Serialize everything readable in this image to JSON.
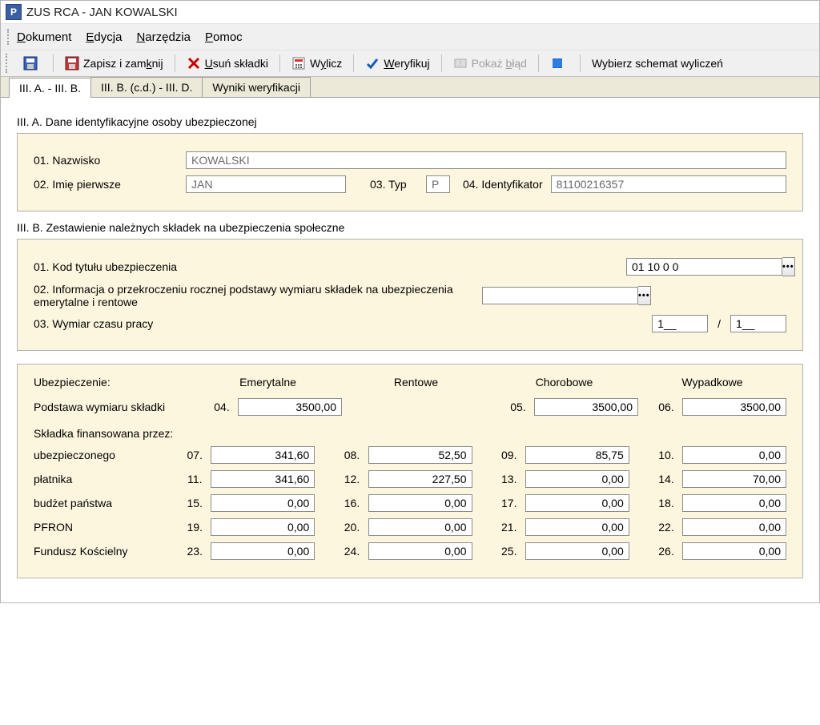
{
  "window_title": "ZUS RCA - JAN KOWALSKI",
  "menus": {
    "dokument": "Dokument",
    "edycja": "Edycja",
    "narzedzia": "Narzędzia",
    "pomoc": "Pomoc"
  },
  "toolbar": {
    "zapisz_i_zamknij": "Zapisz i zamknij",
    "usun_skladki": "Usuń składki",
    "wylicz": "Wylicz",
    "weryfikuj": "Weryfikuj",
    "pokaz_blad": "Pokaż błąd",
    "wybierz_schemat": "Wybierz schemat wyliczeń"
  },
  "tabs": {
    "tab1": "III. A. - III. B.",
    "tab2": "III. B. (c.d.) - III. D.",
    "tab3": "Wyniki weryfikacji"
  },
  "sectionA": {
    "header": "III. A. Dane identyfikacyjne osoby ubezpieczonej",
    "l_nazwisko": "01. Nazwisko",
    "v_nazwisko": "KOWALSKI",
    "l_imie": "02. Imię pierwsze",
    "v_imie": "JAN",
    "l_typ": "03. Typ",
    "v_typ": "P",
    "l_id": "04. Identyfikator",
    "v_id": "81100216357"
  },
  "sectionB": {
    "header": "III. B. Zestawienie należnych składek na ubezpieczenia społeczne",
    "l_kod": "01. Kod tytułu ubezpieczenia",
    "v_kod": "01 10 0 0",
    "l_info": "02. Informacja o przekroczeniu rocznej podstawy wymiaru składek na ubezpieczenia emerytalne i rentowe",
    "v_info": "",
    "l_wym": "03. Wymiar czasu pracy",
    "wym_a": "1__",
    "wym_sep": "/",
    "wym_b": "1__"
  },
  "grid": {
    "h_ubezp": "Ubezpieczenie:",
    "h_emeryt": "Emerytalne",
    "h_rent": "Rentowe",
    "h_chor": "Chorobowe",
    "h_wyp": "Wypadkowe",
    "h_podstawa": "Podstawa wymiaru składki",
    "h_finansowana": "Składka finansowana przez:",
    "basis": {
      "n04": "04.",
      "v04": "3500,00",
      "n05": "05.",
      "v05": "3500,00",
      "n06": "06.",
      "v06": "3500,00"
    },
    "rows": {
      "r1l": "ubezpieczonego",
      "r1": {
        "n1": "07.",
        "v1": "341,60",
        "n2": "08.",
        "v2": "52,50",
        "n3": "09.",
        "v3": "85,75",
        "n4": "10.",
        "v4": "0,00"
      },
      "r2l": "płatnika",
      "r2": {
        "n1": "11.",
        "v1": "341,60",
        "n2": "12.",
        "v2": "227,50",
        "n3": "13.",
        "v3": "0,00",
        "n4": "14.",
        "v4": "70,00"
      },
      "r3l": "budżet państwa",
      "r3": {
        "n1": "15.",
        "v1": "0,00",
        "n2": "16.",
        "v2": "0,00",
        "n3": "17.",
        "v3": "0,00",
        "n4": "18.",
        "v4": "0,00"
      },
      "r4l": "PFRON",
      "r4": {
        "n1": "19.",
        "v1": "0,00",
        "n2": "20.",
        "v2": "0,00",
        "n3": "21.",
        "v3": "0,00",
        "n4": "22.",
        "v4": "0,00"
      },
      "r5l": "Fundusz Kościelny",
      "r5": {
        "n1": "23.",
        "v1": "0,00",
        "n2": "24.",
        "v2": "0,00",
        "n3": "25.",
        "v3": "0,00",
        "n4": "26.",
        "v4": "0,00"
      }
    }
  }
}
